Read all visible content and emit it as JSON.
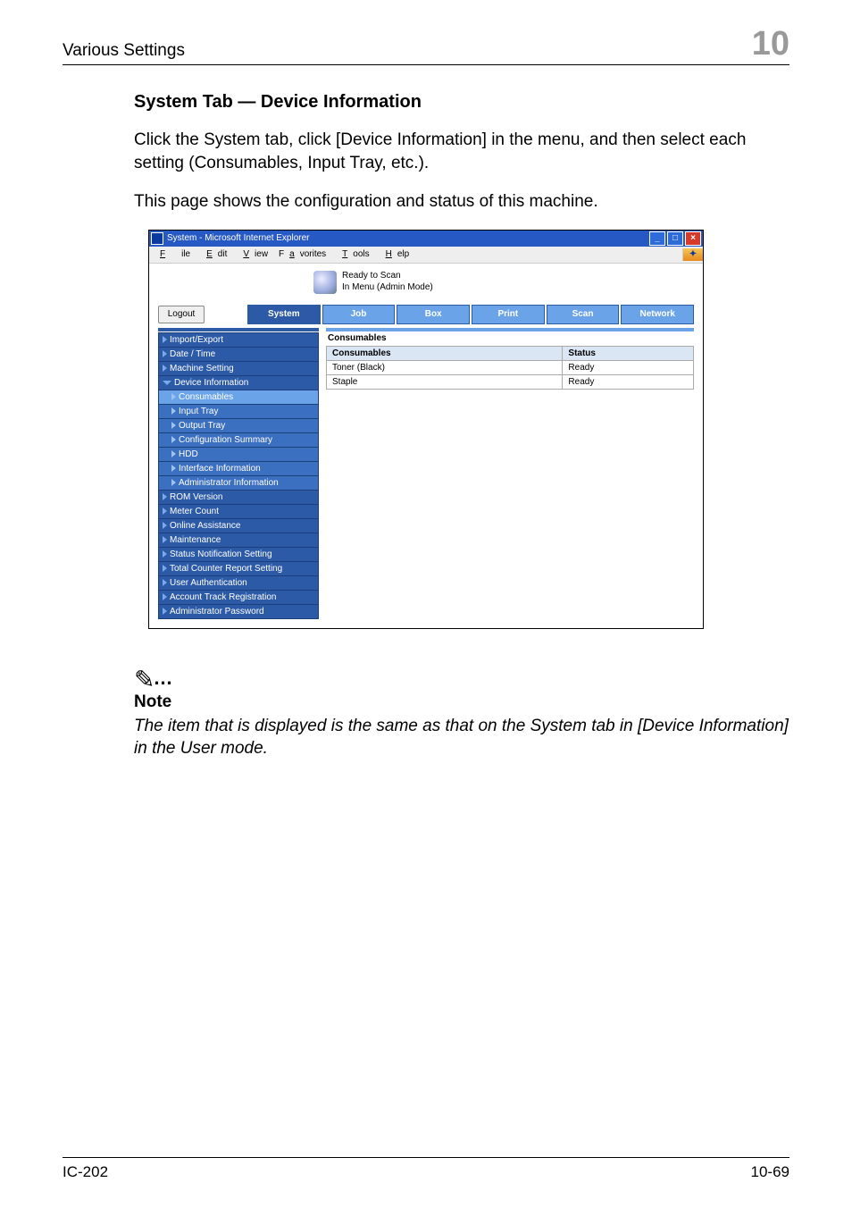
{
  "header": {
    "breadcrumb": "Various Settings",
    "chapter_number": "10"
  },
  "section": {
    "title": "System Tab — Device Information"
  },
  "body": {
    "p1": "Click the System tab, click [Device Information] in the menu, and then select each setting (Consumables, Input Tray, etc.).",
    "p2": "This page shows the configuration and status of this machine."
  },
  "screenshot": {
    "window_title": "System - Microsoft Internet Explorer",
    "menu": {
      "file": "File",
      "edit": "Edit",
      "view": "View",
      "favorites": "Favorites",
      "tools": "Tools",
      "help": "Help"
    },
    "status": {
      "line1": "Ready to Scan",
      "line2": "In Menu (Admin Mode)"
    },
    "logout": "Logout",
    "tabs": {
      "system": "System",
      "job": "Job",
      "box": "Box",
      "print": "Print",
      "scan": "Scan",
      "network": "Network"
    },
    "sidebar": {
      "items": [
        "Import/Export",
        "Date / Time",
        "Machine Setting",
        "Device Information",
        "ROM Version",
        "Meter Count",
        "Online Assistance",
        "Maintenance",
        "Status Notification Setting",
        "Total Counter Report Setting",
        "User Authentication",
        "Account Track Registration",
        "Administrator Password"
      ],
      "device_info_children": [
        "Consumables",
        "Input Tray",
        "Output Tray",
        "Configuration Summary",
        "HDD",
        "Interface Information",
        "Administrator Information"
      ]
    },
    "main": {
      "heading": "Consumables",
      "table": {
        "head": [
          "Consumables",
          "Status"
        ],
        "rows": [
          [
            "Toner (Black)",
            "Ready"
          ],
          [
            "Staple",
            "Ready"
          ]
        ]
      }
    }
  },
  "note": {
    "label": "Note",
    "text": "The item that is displayed is the same as that on the System tab in [Device Information] in the User mode."
  },
  "footer": {
    "left": "IC-202",
    "right": "10-69"
  }
}
